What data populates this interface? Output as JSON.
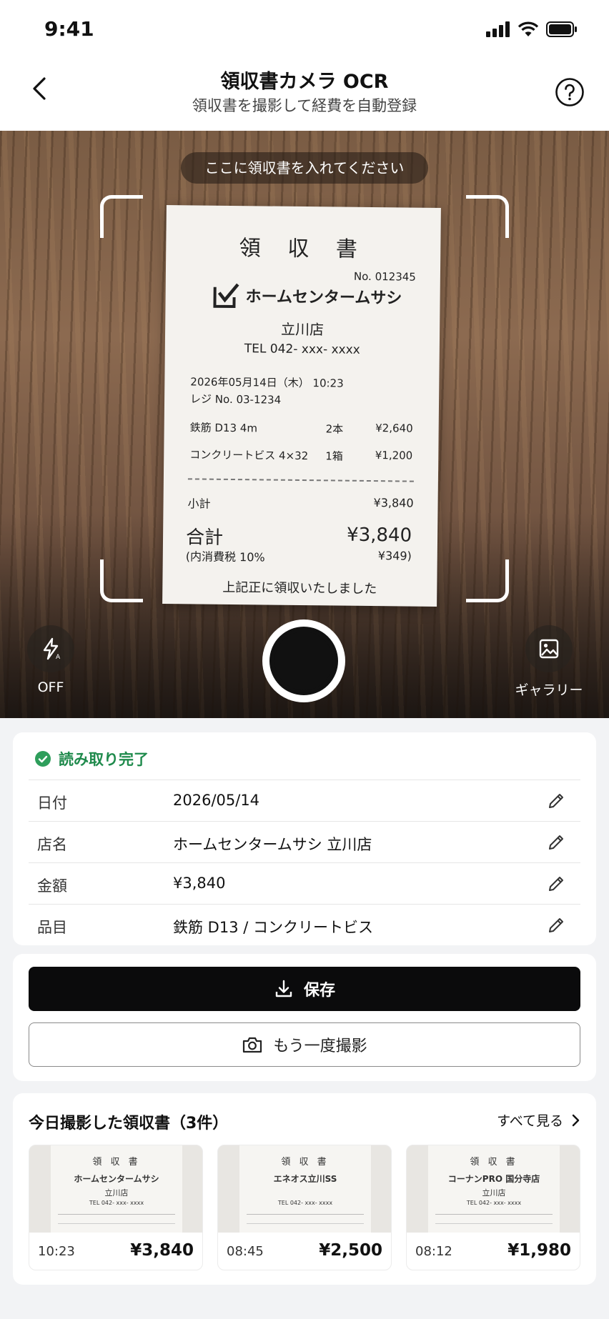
{
  "status": {
    "time": "9:41"
  },
  "header": {
    "title": "領収書カメラ OCR",
    "subtitle": "領収書を撮影して経費を自動登録"
  },
  "camera": {
    "hint": "ここに領収書を入れてください",
    "flash_label": "OFF",
    "gallery_label": "ギャラリー",
    "receipt": {
      "title": "領 収 書",
      "number": "No. 012345",
      "store": "ホームセンタームサシ",
      "branch": "立川店",
      "tel": "TEL 042- xxx- xxxx",
      "datetime": "2026年05月14日（木） 10:23",
      "register": "レジ No. 03-1234",
      "items": [
        {
          "name": "鉄筋 D13 4m",
          "qty": "2本",
          "price": "¥2,640"
        },
        {
          "name": "コンクリートビス 4×32",
          "qty": "1箱",
          "price": "¥1,200"
        }
      ],
      "subtotal_label": "小計",
      "subtotal": "¥3,840",
      "total_label": "合計",
      "total": "¥3,840",
      "tax_label": "(内消費税 10%",
      "tax": "¥349)",
      "footer": "上記正に領収いたしました"
    }
  },
  "result": {
    "status": "読み取り完了",
    "fields": [
      {
        "label": "日付",
        "value": "2026/05/14"
      },
      {
        "label": "店名",
        "value": "ホームセンタームサシ 立川店"
      },
      {
        "label": "金額",
        "value": "¥3,840"
      },
      {
        "label": "品目",
        "value": "鉄筋 D13 / コンクリートビス"
      }
    ]
  },
  "actions": {
    "save_label": "保存",
    "retake_label": "もう一度撮影"
  },
  "history": {
    "title": "今日撮影した領収書（3件）",
    "see_all": "すべて見る",
    "items": [
      {
        "doc_title": "領 収 書",
        "store": "ホームセンタームサシ",
        "branch": "立川店",
        "tel": "TEL 042- xxx- xxxx",
        "time": "10:23",
        "amount": "¥3,840"
      },
      {
        "doc_title": "領 収 書",
        "store": "エネオス立川SS",
        "branch": "",
        "tel": "TEL 042- xxx- xxxx",
        "time": "08:45",
        "amount": "¥2,500"
      },
      {
        "doc_title": "領 収 書",
        "store": "コーナンPRO 国分寺店",
        "branch": "立川店",
        "tel": "TEL 042- xxx- xxxx",
        "time": "08:12",
        "amount": "¥1,980"
      }
    ]
  },
  "colors": {
    "accent_green": "#1f8a4c",
    "primary_button": "#0b0b0c"
  },
  "icons": [
    "back-icon",
    "help-icon",
    "signal-icon",
    "wifi-icon",
    "battery-icon",
    "flash-off-icon",
    "gallery-icon",
    "check-circle-icon",
    "edit-icon",
    "download-icon",
    "camera-icon",
    "chevron-right-icon"
  ]
}
